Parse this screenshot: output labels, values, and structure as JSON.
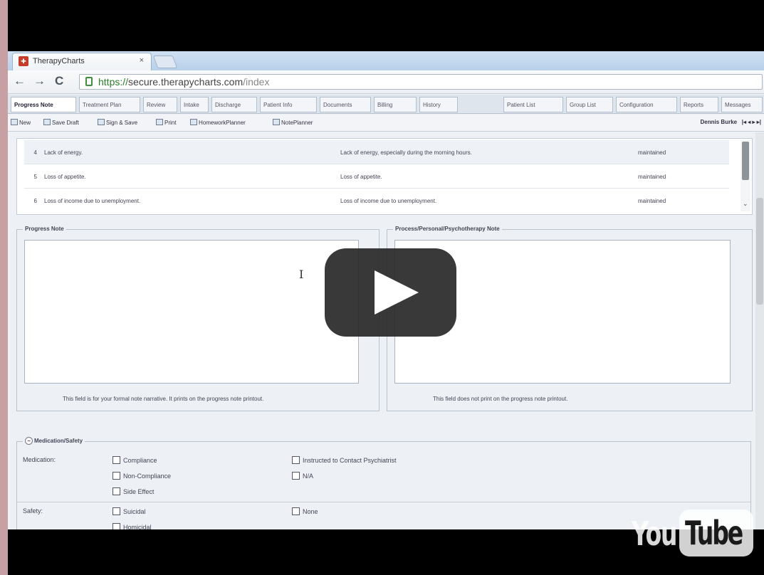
{
  "browser": {
    "tab_title": "TherapyCharts",
    "tab_close": "×",
    "url_https": "https://",
    "url_host": "secure.therapycharts.com",
    "url_path": "/index",
    "back_icon": "←",
    "forward_icon": "→",
    "reload_icon": "C"
  },
  "app_tabs": [
    {
      "label": "Progress Note"
    },
    {
      "label": "Treatment Plan"
    },
    {
      "label": "Review"
    },
    {
      "label": "Intake"
    },
    {
      "label": "Discharge"
    },
    {
      "label": "Patient Info"
    },
    {
      "label": "Documents"
    },
    {
      "label": "Billing"
    },
    {
      "label": "History"
    },
    {
      "label": "Patient List"
    },
    {
      "label": "Group List"
    },
    {
      "label": "Configuration"
    },
    {
      "label": "Reports"
    },
    {
      "label": "Messages"
    }
  ],
  "toolbar": {
    "new": "New",
    "save_draft": "Save Draft",
    "sign_save": "Sign & Save",
    "print": "Print",
    "homework": "HomeworkPlanner",
    "note_planner": "NotePlanner",
    "patient": "Dennis Burke",
    "nav": "|◂  ◂  ▸  ▸|"
  },
  "grid_rows": [
    {
      "num": "4",
      "problem": "Lack of energy.",
      "description": "Lack of energy, especially during the morning hours.",
      "status": "maintained"
    },
    {
      "num": "5",
      "problem": "Loss of appetite.",
      "description": "Loss of appetite.",
      "status": "maintained"
    },
    {
      "num": "6",
      "problem": "Loss of income due to unemployment.",
      "description": "Loss of income due to unemployment.",
      "status": "maintained"
    }
  ],
  "progress_note": {
    "legend": "Progress Note",
    "hint": "This field is for your formal note narrative. It prints on the progress note printout."
  },
  "process_note": {
    "legend": "Process/Personal/Psychotherapy Note",
    "hint": "This field does not print on the progress note printout."
  },
  "medication": {
    "legend": "Medication/Safety",
    "collapse": "−",
    "medication_label": "Medication:",
    "safety_label": "Safety:",
    "med_col1": [
      "Compliance",
      "Non-Compliance",
      "Side Effect"
    ],
    "med_col2": [
      "Instructed to Contact Psychiatrist",
      "N/A"
    ],
    "safety_col1": [
      "Suicidal",
      "Homicidal"
    ],
    "safety_col2": [
      "None"
    ]
  },
  "youtube": {
    "you": "You",
    "tube": "Tube"
  }
}
